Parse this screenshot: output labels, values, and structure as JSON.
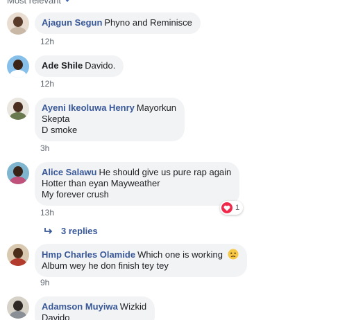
{
  "sort": {
    "label": "Most relevant"
  },
  "comments": [
    {
      "author": "Ajagun Segun",
      "lines": [
        "Phyno and Reminisce"
      ],
      "time": "12h"
    },
    {
      "author": "Ade Shile",
      "lines": [
        "Davido."
      ],
      "time": "12h"
    },
    {
      "author": "Ayeni Ikeoluwa Henry",
      "lines": [
        "Mayorkun",
        "Skepta",
        "D smoke"
      ],
      "time": "3h"
    },
    {
      "author": "Alice Salawu",
      "lines": [
        "He should give us pure rap again",
        "Hotter than eyan Mayweather",
        "My forever crush"
      ],
      "time": "13h",
      "reaction_count": "1"
    },
    {
      "author": "Hmp Charles Olamide",
      "lines": [
        "Which one is working",
        "Album wey he don finish tey tey"
      ],
      "time": "9h"
    },
    {
      "author": "Adamson Muyiwa",
      "lines": [
        "Wizkid",
        "Davido"
      ]
    }
  ],
  "replies": {
    "label": "3 replies"
  },
  "colors": {
    "link": "#385898",
    "bubble": "#f2f3f5",
    "meta": "#606770",
    "love": "#f0284a"
  },
  "icons": [
    "chevron-down-icon",
    "love-reaction-icon",
    "reply-arrow-icon",
    "sad-emoji-icon"
  ]
}
